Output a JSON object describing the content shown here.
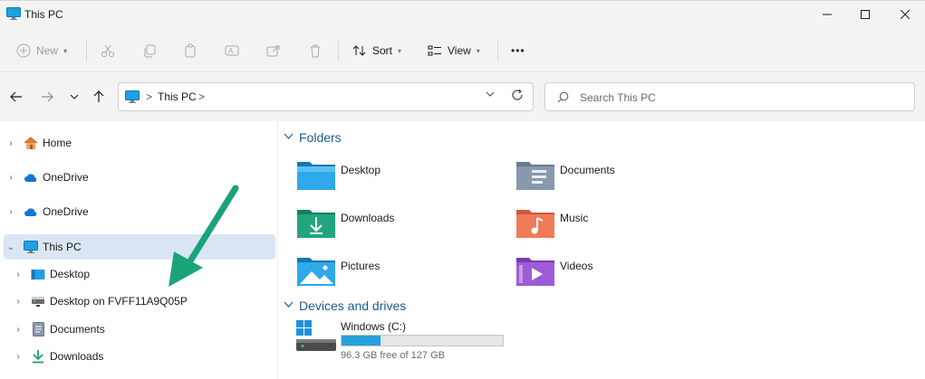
{
  "window": {
    "title": "This PC"
  },
  "toolbar": {
    "new_label": "New",
    "sort_label": "Sort",
    "view_label": "View",
    "more_label": "•••"
  },
  "address": {
    "crumbs": [
      "This PC"
    ],
    "separator": ">"
  },
  "search": {
    "placeholder": "Search This PC"
  },
  "sidebar": {
    "items": [
      {
        "label": "Home",
        "icon": "home-icon",
        "chevron": ">"
      },
      {
        "label": "OneDrive",
        "icon": "onedrive-cloud-icon",
        "chevron": ">"
      },
      {
        "label": "OneDrive",
        "icon": "onedrive-cloud-icon",
        "chevron": ">"
      },
      {
        "label": "This PC",
        "icon": "monitor-icon",
        "chevron": "v",
        "selected": true
      },
      {
        "label": "Desktop",
        "icon": "desktop-folder-icon",
        "chevron": ">"
      },
      {
        "label": "Desktop on FVFF11A9Q05P",
        "icon": "network-drive-icon",
        "chevron": ">"
      },
      {
        "label": "Documents",
        "icon": "documents-icon",
        "chevron": ">"
      },
      {
        "label": "Downloads",
        "icon": "downloads-icon",
        "chevron": ">"
      }
    ]
  },
  "main": {
    "folders_header": "Folders",
    "folders": [
      {
        "label": "Desktop",
        "icon": "desktop-folder-icon"
      },
      {
        "label": "Documents",
        "icon": "documents-folder-icon"
      },
      {
        "label": "Downloads",
        "icon": "downloads-folder-icon"
      },
      {
        "label": "Music",
        "icon": "music-folder-icon"
      },
      {
        "label": "Pictures",
        "icon": "pictures-folder-icon"
      },
      {
        "label": "Videos",
        "icon": "videos-folder-icon"
      }
    ],
    "drives_header": "Devices and drives",
    "drives": [
      {
        "label": "Windows (C:)",
        "free_text": "96.3 GB free of 127 GB",
        "used_fraction": 0.242
      }
    ]
  },
  "colors": {
    "accent": "#1e5a96",
    "selection": "#dbe6f5",
    "drive_fill": "#26a0da",
    "annotation_arrow": "#1aa37a"
  }
}
